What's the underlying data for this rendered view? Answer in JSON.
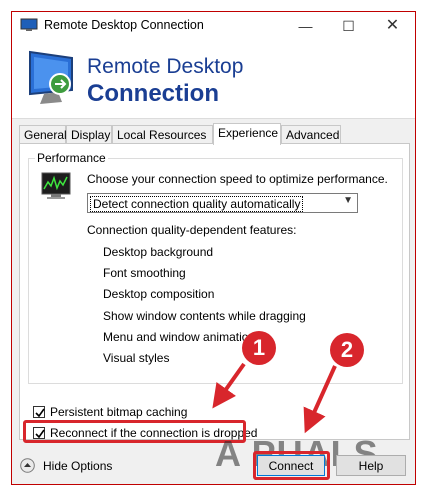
{
  "window": {
    "title": "Remote Desktop Connection",
    "controls": {
      "minimize": "—",
      "maximize": "☐",
      "close": "✕"
    }
  },
  "banner": {
    "line1": "Remote Desktop",
    "line2": "Connection"
  },
  "tabs": [
    {
      "label": "General",
      "active": false
    },
    {
      "label": "Display",
      "active": false
    },
    {
      "label": "Local Resources",
      "active": false
    },
    {
      "label": "Experience",
      "active": true
    },
    {
      "label": "Advanced",
      "active": false
    }
  ],
  "experience": {
    "group_label": "Performance",
    "description": "Choose your connection speed to optimize performance.",
    "speed_select": {
      "value": "Detect connection quality automatically"
    },
    "features_label": "Connection quality-dependent features:",
    "features": [
      "Desktop background",
      "Font smoothing",
      "Desktop composition",
      "Show window contents while dragging",
      "Menu and window animation",
      "Visual styles"
    ],
    "persistent_bitmap": {
      "label": "Persistent bitmap caching",
      "checked": true
    },
    "reconnect": {
      "label": "Reconnect if the connection is dropped",
      "checked": true
    }
  },
  "footer": {
    "hide_options": "Hide Options",
    "connect": "Connect",
    "help": "Help"
  },
  "annotations": {
    "badge1": "1",
    "badge2": "2"
  },
  "watermark": "A PUALS",
  "colors": {
    "highlight": "#d8262c",
    "banner_text": "#1a3e93",
    "window_border": "#c00000"
  },
  "icons": {
    "app": "monitor-icon",
    "banner": "remote-desktop-icon",
    "performance": "performance-monitor-icon",
    "hide_options": "chevron-up-icon"
  }
}
